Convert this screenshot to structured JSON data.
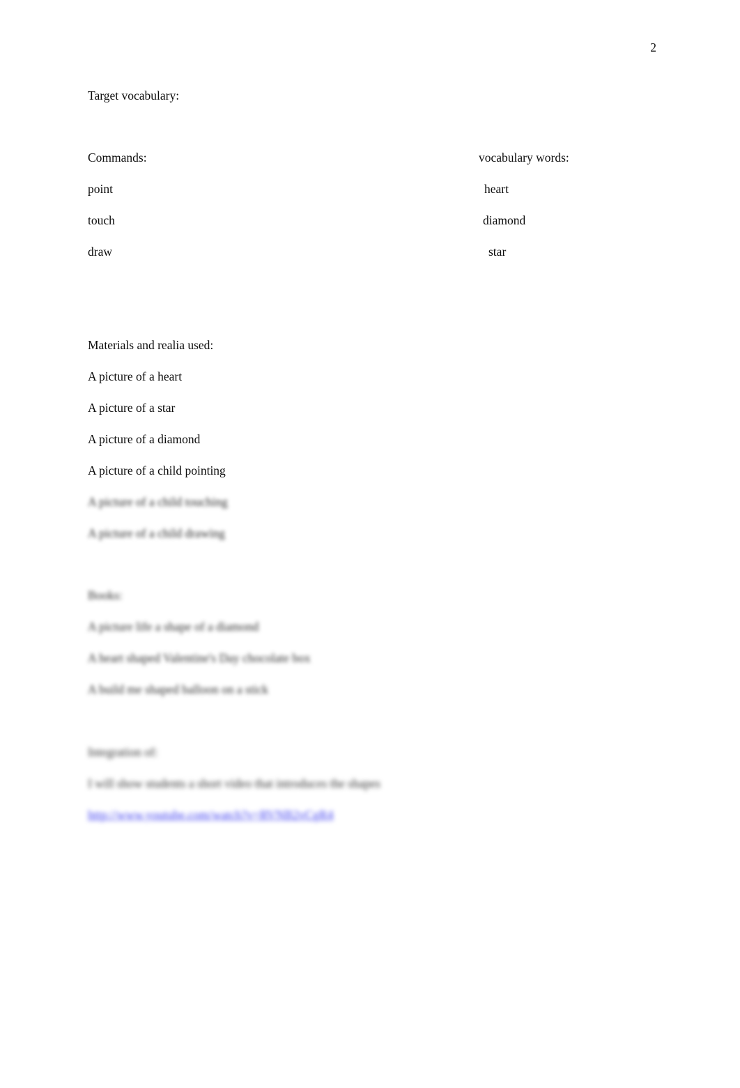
{
  "document": {
    "page_number": "2",
    "background_color": "#ffffff",
    "text_color": "#0d0d0d",
    "hyperlink_color": "#3c3cf0"
  },
  "sections": {
    "target_vocabulary": {
      "heading": "Target vocabulary:",
      "columns": {
        "left_header": "Commands:",
        "right_header": "vocabulary words:"
      },
      "rows": [
        {
          "command": "point",
          "word": "heart"
        },
        {
          "command": "touch",
          "word": "diamond"
        },
        {
          "command": "draw",
          "word": "star"
        }
      ]
    },
    "materials": {
      "heading": "Materials and realia used:",
      "items": [
        {
          "text": "A picture of a heart",
          "blurred": false
        },
        {
          "text": "A picture of a star",
          "blurred": false
        },
        {
          "text": "A picture of a diamond",
          "blurred": false
        },
        {
          "text": "A picture of a child pointing",
          "blurred": false
        },
        {
          "text": "A picture of a child touching",
          "blurred": true
        },
        {
          "text": "A picture of a child drawing",
          "blurred": true
        }
      ]
    },
    "books": {
      "heading": "Books:",
      "items": [
        "A picture life a shape of a diamond",
        "A heart shaped Valentine's Day chocolate box",
        "A build me shaped balloon on a stick"
      ]
    },
    "integration": {
      "heading": "Integration of:",
      "body": "I will show students a short video that introduces the shapes",
      "link": "http://www.youtube.com/watch?v=RVNB2vCgR4"
    }
  }
}
